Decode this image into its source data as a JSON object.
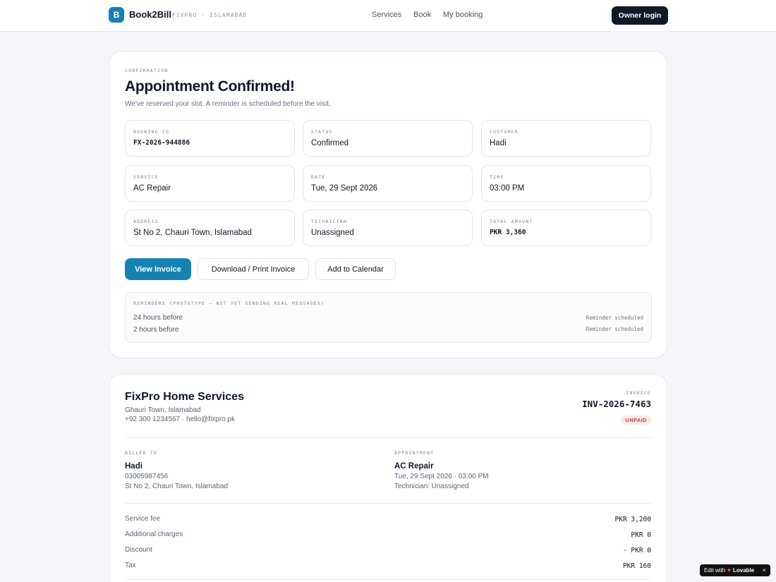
{
  "header": {
    "logo_letter": "B",
    "brand": "Book2Bill",
    "subtitle": "FIXPRO · ISLAMABAD",
    "nav": [
      "Services",
      "Book",
      "My booking"
    ],
    "owner_login": "Owner login"
  },
  "confirmation": {
    "eyebrow": "CONFIRMATION",
    "title": "Appointment Confirmed!",
    "subtitle": "We've reserved your slot. A reminder is scheduled before the visit.",
    "fields": [
      {
        "label": "BOOKING ID",
        "value": "FX-2026-944886"
      },
      {
        "label": "STATUS",
        "value": "Confirmed"
      },
      {
        "label": "CUSTOMER",
        "value": "Hadi"
      },
      {
        "label": "SERVICE",
        "value": "AC Repair"
      },
      {
        "label": "DATE",
        "value": "Tue, 29 Sept 2026"
      },
      {
        "label": "TIME",
        "value": "03:00 PM"
      },
      {
        "label": "ADDRESS",
        "value": "St No 2, Chauri Town, Islamabad"
      },
      {
        "label": "TECHNICIAN",
        "value": "Unassigned"
      },
      {
        "label": "TOTAL AMOUNT",
        "value": "PKR 3,360"
      }
    ],
    "buttons": {
      "view_invoice": "View Invoice",
      "download_print": "Download / Print Invoice",
      "add_calendar": "Add to Calendar"
    },
    "reminders": {
      "title": "REMINDERS (PROTOTYPE — NOT YET SENDING REAL MESSAGES)",
      "items": [
        {
          "label": "24 hours before",
          "status": "Reminder scheduled"
        },
        {
          "label": "2 hours before",
          "status": "Reminder scheduled"
        }
      ]
    }
  },
  "invoice": {
    "business_name": "FixPro Home Services",
    "business_address": "Ghauri Town, Islamabad",
    "business_contact": "+92 300 1234567 · hello@fixpro.pk",
    "invoice_label": "INVOICE",
    "invoice_number": "INV-2026-7463",
    "status_badge": "UNPAID",
    "billed_to": {
      "label": "BILLED TO",
      "name": "Hadi",
      "phone": "03005987456",
      "address": "St No 2, Chauri Town, Islamabad"
    },
    "appointment": {
      "label": "APPOINTMENT",
      "service": "AC Repair",
      "datetime": "Tue, 29 Sept 2026 · 03:00 PM",
      "technician": "Technician: Unassigned"
    },
    "lines": [
      {
        "label": "Service fee",
        "amount": "PKR 3,200"
      },
      {
        "label": "Additional charges",
        "amount": "PKR 0"
      },
      {
        "label": "Discount",
        "amount": "- PKR 0"
      },
      {
        "label": "Tax",
        "amount": "PKR 160"
      }
    ]
  },
  "badge": {
    "prefix": "Edit with",
    "brand": "Lovable",
    "close": "×"
  },
  "colors": {
    "accent": "#1582b4",
    "dark_button": "#111827",
    "unpaid_bg": "#fde8e8",
    "unpaid_text": "#c2413b"
  }
}
